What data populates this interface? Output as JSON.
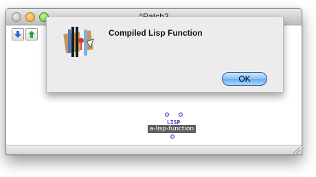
{
  "window": {
    "title": "^Patch3"
  },
  "toolbar": {
    "move_down_icon": "arrow-down-icon",
    "move_up_icon": "arrow-up-icon"
  },
  "patch_box": {
    "tag": "LISP",
    "label": "a-lisp-function"
  },
  "dialog": {
    "message": "Compiled Lisp Function",
    "ok_label": "OK",
    "icon": "openmusic-icon"
  },
  "colors": {
    "accent_blue": "#6aaeee",
    "box_label_bg": "#5f5f5f",
    "lisp_tag": "#3a3ad0"
  }
}
